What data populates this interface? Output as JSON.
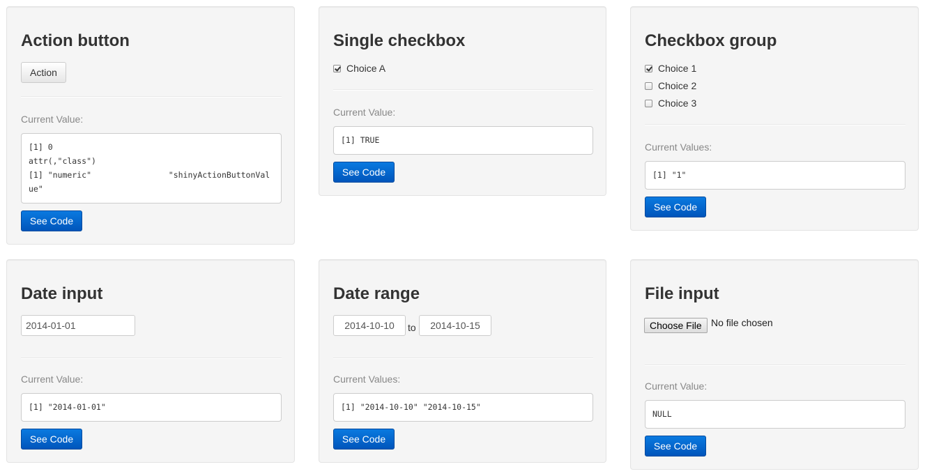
{
  "panels": {
    "action_button": {
      "title": "Action button",
      "button_label": "Action",
      "value_label": "Current Value:",
      "output": "[1] 0\nattr(,\"class\")\n[1] \"numeric\"                \"shinyActionButtonValue\"",
      "code_button": "See Code"
    },
    "single_checkbox": {
      "title": "Single checkbox",
      "checkbox_label": "Choice A",
      "checked": true,
      "value_label": "Current Value:",
      "output": "[1] TRUE",
      "code_button": "See Code"
    },
    "checkbox_group": {
      "title": "Checkbox group",
      "options": [
        {
          "label": "Choice 1",
          "checked": true
        },
        {
          "label": "Choice 2",
          "checked": false
        },
        {
          "label": "Choice 3",
          "checked": false
        }
      ],
      "value_label": "Current Values:",
      "output": "[1] \"1\"",
      "code_button": "See Code"
    },
    "date_input": {
      "title": "Date input",
      "value": "2014-01-01",
      "value_label": "Current Value:",
      "output": "[1] \"2014-01-01\"",
      "code_button": "See Code"
    },
    "date_range": {
      "title": "Date range",
      "start": "2014-10-10",
      "separator": "to",
      "end": "2014-10-15",
      "value_label": "Current Values:",
      "output": "[1] \"2014-10-10\" \"2014-10-15\"",
      "code_button": "See Code"
    },
    "file_input": {
      "title": "File input",
      "choose_label": "Choose File",
      "status": "No file chosen",
      "value_label": "Current Value:",
      "output": "NULL",
      "code_button": "See Code"
    }
  }
}
